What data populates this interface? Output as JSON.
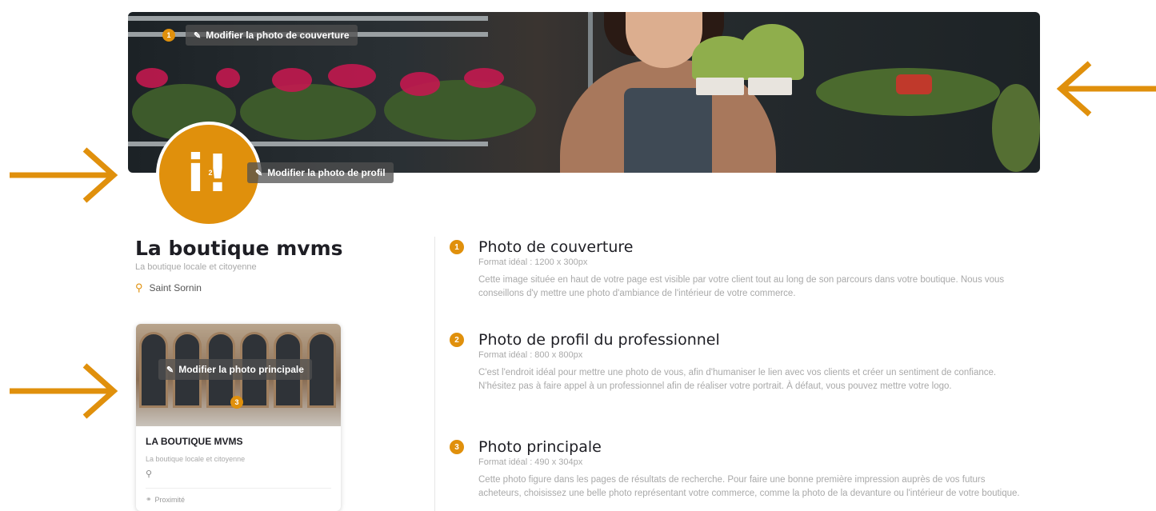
{
  "cover": {
    "step_number": "1",
    "edit_label": "Modifier la photo de couverture"
  },
  "profile": {
    "step_number": "2",
    "edit_label": "Modifier la photo de profil",
    "logo_text": "i!"
  },
  "shop": {
    "name": "La boutique mvms",
    "tagline": "La boutique locale et citoyenne",
    "location": "Saint Sornin"
  },
  "card": {
    "step_number": "3",
    "edit_label": "Modifier la photo principale",
    "title": "LA BOUTIQUE MVMS",
    "tagline": "La boutique locale et citoyenne",
    "proximity": "Proximité"
  },
  "sections": [
    {
      "number": "1",
      "title": "Photo de couverture",
      "format": "Format idéal : 1200 x 300px",
      "description": "Cette image située en haut de votre page est visible par votre client tout au long de son parcours dans votre boutique. Nous vous conseillons d'y mettre une photo d'ambiance de l'intérieur de votre commerce."
    },
    {
      "number": "2",
      "title": "Photo de profil du professionnel",
      "format": "Format idéal : 800 x 800px",
      "description": "C'est l'endroit idéal pour mettre une photo de vous, afin d'humaniser le lien avec vos clients et créer un sentiment de confiance. N'hésitez pas à faire appel à un professionnel afin de réaliser votre portrait. À défaut, vous pouvez mettre votre logo."
    },
    {
      "number": "3",
      "title": "Photo principale",
      "format": "Format idéal : 490 x 304px",
      "description": "Cette photo figure dans les pages de résultats de recherche. Pour faire une bonne première impression auprès de vos futurs acheteurs, choisissez une belle photo représentant votre commerce, comme la photo de la devanture ou l'intérieur de votre boutique."
    }
  ],
  "colors": {
    "accent": "#e0900c",
    "text_dark": "#1e1e24",
    "text_muted": "#a9a9a9"
  },
  "icons": [
    "pencil-icon",
    "map-pin-icon",
    "bike-icon",
    "arrow-icon"
  ]
}
